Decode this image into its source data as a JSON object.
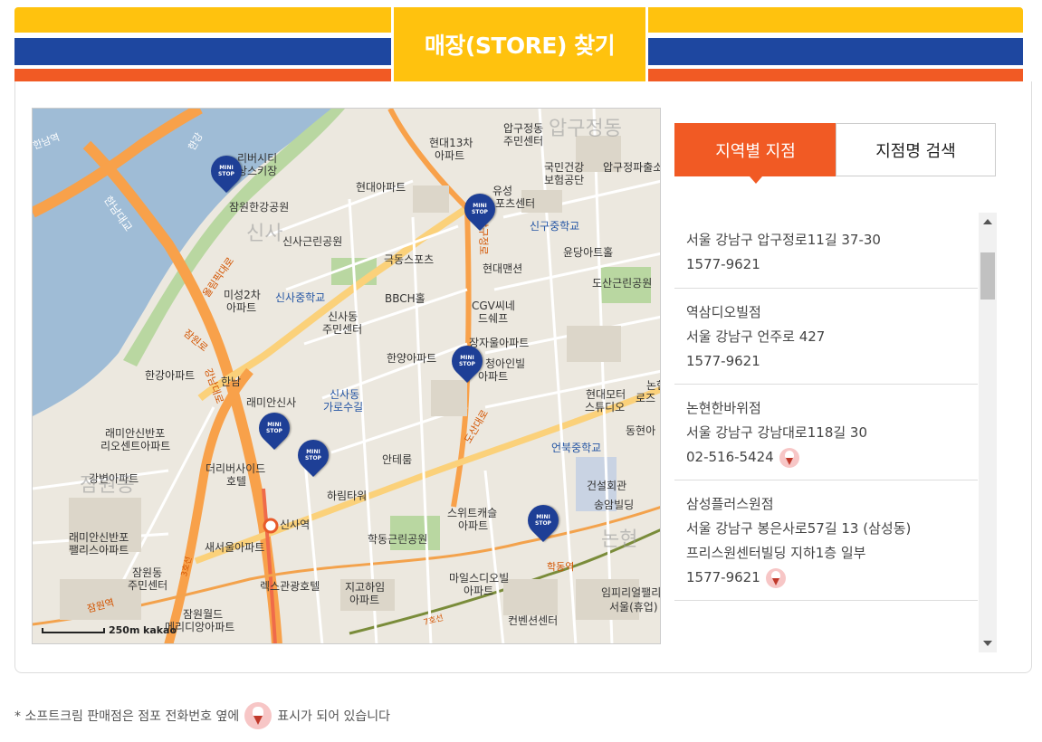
{
  "header": {
    "title": "매장(STORE) 찾기"
  },
  "tabs": [
    {
      "label": "지역별 지점",
      "active": true
    },
    {
      "label": "지점명 검색",
      "active": false
    }
  ],
  "stores": [
    {
      "name": "",
      "address": "서울 강남구 압구정로11길 37-30",
      "phone": "1577-9621",
      "soft_cream": false
    },
    {
      "name": "역삼디오빌점",
      "address": "서울 강남구 언주로 427",
      "phone": "1577-9621",
      "soft_cream": false
    },
    {
      "name": "논현한바위점",
      "address": "서울 강남구 강남대로118길 30",
      "phone": "02-516-5424",
      "soft_cream": true
    },
    {
      "name": "삼성플러스원점",
      "address": "서울 강남구 봉은사로57길 13 (삼성동)",
      "detail": "프리스원센터빌딩 지하1층 일부",
      "phone": "1577-9621",
      "soft_cream": true
    }
  ],
  "map": {
    "labels": {
      "l1": "리버시티",
      "l2": "상스키장",
      "l3": "잠원한강공원",
      "l4": "신사근린공원",
      "l5": "현대아파트",
      "l6": "현대13차",
      "l7": "아파트",
      "l8": "압구정동",
      "l9": "주민센터",
      "l10": "국민건강",
      "l11": "보험공단",
      "l12": "압구정파출소",
      "l13": "유성",
      "l14": "스포츠센터",
      "l15": "신구중학교",
      "l16": "윤당아트홀",
      "l17": "극동스포츠",
      "l18": "현대맨션",
      "l19": "도산근린공원",
      "l20": "미성2차",
      "l21": "아파트",
      "l22": "신사중학교",
      "l23": "BBCH홀",
      "l24": "CGV씨네",
      "l25": "드쉐프",
      "l26": "신사동",
      "l27": "주민센터",
      "l28": "장자울아파트",
      "l29": "한양아파트",
      "l30": "청아인빌",
      "l31": "아파트",
      "l32": "한강아파트",
      "l33": "신사동",
      "l34": "가로수길",
      "l35": "현대모터",
      "l36": "스튜디오",
      "l37": "래미안신사",
      "l38": "래미안신반포",
      "l39": "리오센트아파트",
      "l40": "언북중학교",
      "l41": "더리버사이드",
      "l42": "호텔",
      "l43": "안테룸",
      "l44": "강변아파트",
      "l45": "하림타워",
      "l46": "건설회관",
      "l47": "송암빌딩",
      "l48": "스위트캐슬",
      "l49": "아파트",
      "l50": "신사역",
      "l51": "래미안신반포",
      "l52": "팰리스아파트",
      "l53": "새서울아파트",
      "l54": "학동근린공원",
      "l55": "잠원동",
      "l56": "주민센터",
      "l57": "렉스관광호텔",
      "l58": "지고하임",
      "l59": "아파트",
      "l60": "마일스디오빌",
      "l61": "아파트",
      "l62": "임피리얼팰리",
      "l63": "서울(휴업)",
      "l64": "잠원월드",
      "l65": "메리디앙아파트",
      "l66": "컨벤션센터",
      "l67": "한남",
      "l68": "동현아",
      "l69": "논현",
      "l70": "로즈",
      "l71": "신사",
      "l72": "잠원동",
      "l73": "압구정동",
      "l74": "논현"
    },
    "roads": {
      "r1": "압구정로",
      "r2": "강남대로",
      "r3": "올림픽대로",
      "r4": "잠원로",
      "r5": "도산대로",
      "r6": "한남대교",
      "r7": "학동역",
      "r8": "잠원역",
      "r9": "7호선",
      "r10": "3호선",
      "r11": "한강",
      "r12": "한남역"
    },
    "pins": [
      "MINI STOP",
      "MINI STOP",
      "MINI STOP",
      "MINI STOP",
      "MINI STOP",
      "MINI STOP"
    ],
    "scale": {
      "distance": "250m",
      "brand": "kakao"
    }
  },
  "footnote": {
    "before": "* 소프트크림 판매점은 점포 전화번호 옆에",
    "after": "표시가 되어 있습니다"
  },
  "colors": {
    "yellow": "#ffc20e",
    "blue": "#1e47a0",
    "orange": "#f15a24",
    "pin": "#1e3f96"
  }
}
